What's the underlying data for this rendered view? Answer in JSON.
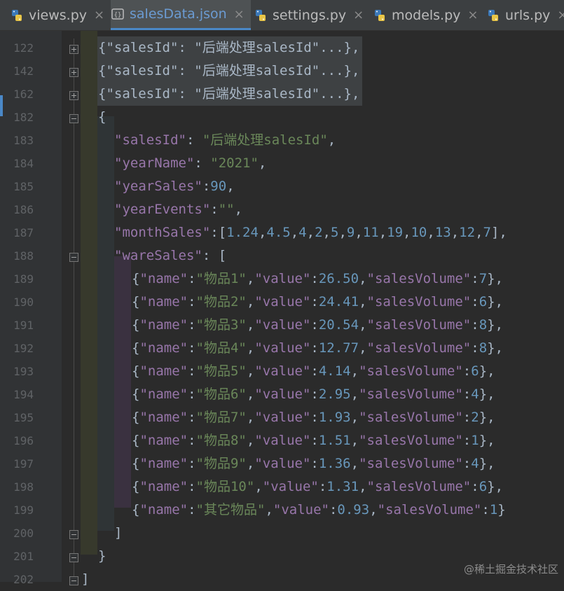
{
  "tabs": [
    {
      "label": "views.py",
      "active": false,
      "icon": "python-file-icon"
    },
    {
      "label": "salesData.json",
      "active": true,
      "icon": "json-file-icon"
    },
    {
      "label": "settings.py",
      "active": false,
      "icon": "python-file-icon"
    },
    {
      "label": "models.py",
      "active": false,
      "icon": "python-file-icon"
    },
    {
      "label": "urls.py",
      "active": false,
      "icon": "python-file-icon"
    }
  ],
  "tab_close_glyph": "×",
  "line_numbers": [
    "122",
    "142",
    "162",
    "182",
    "183",
    "184",
    "185",
    "186",
    "187",
    "188",
    "189",
    "190",
    "191",
    "192",
    "193",
    "194",
    "195",
    "196",
    "197",
    "198",
    "199",
    "200",
    "201",
    "202"
  ],
  "collapsed_text": "{\"salesId\": \"后端处理salesId\"...},",
  "code": {
    "l182": "{",
    "l183": [
      "\"salesId\"",
      ": ",
      "\"后端处理salesId\"",
      ","
    ],
    "l184": [
      "\"yearName\"",
      ": ",
      "\"2021\"",
      ","
    ],
    "l185": [
      "\"yearSales\"",
      ":",
      "90",
      ","
    ],
    "l186": [
      "\"yearEvents\"",
      ":",
      "\"\"",
      ","
    ],
    "l187": [
      "\"monthSales\"",
      ":[",
      "1.24",
      ",",
      "4.5",
      ",",
      "4",
      ",",
      "2",
      ",",
      "5",
      ",",
      "9",
      ",",
      "11",
      ",",
      "19",
      ",",
      "10",
      ",",
      "13",
      ",",
      "12",
      ",",
      "7",
      "],"
    ],
    "l188": [
      "\"wareSales\"",
      ": ["
    ],
    "l200": "]",
    "l201": "}",
    "l202": "]"
  },
  "ware_sales": [
    {
      "name": "\"物品1\"",
      "value": "26.50",
      "volume": "7",
      "tail": "},"
    },
    {
      "name": "\"物品2\"",
      "value": "24.41",
      "volume": "6",
      "tail": "},"
    },
    {
      "name": "\"物品3\"",
      "value": "20.54",
      "volume": "8",
      "tail": "},"
    },
    {
      "name": "\"物品4\"",
      "value": "12.77",
      "volume": "8",
      "tail": "},"
    },
    {
      "name": "\"物品5\"",
      "value": "4.14",
      "volume": "6",
      "tail": "},"
    },
    {
      "name": "\"物品6\"",
      "value": "2.95",
      "volume": "4",
      "tail": "},"
    },
    {
      "name": "\"物品7\"",
      "value": "1.93",
      "volume": "2",
      "tail": "},"
    },
    {
      "name": "\"物品8\"",
      "value": "1.51",
      "volume": "1",
      "tail": "},"
    },
    {
      "name": "\"物品9\"",
      "value": "1.36",
      "volume": "4",
      "tail": "},"
    },
    {
      "name": "\"物品10\"",
      "value": "1.31",
      "volume": "6",
      "tail": "},"
    },
    {
      "name": "\"其它物品\"",
      "value": "0.93",
      "volume": "1",
      "tail": "}"
    }
  ],
  "ware_keys": {
    "open": "{",
    "name_key": "\"name\"",
    "value_key": "\"value\"",
    "volume_key": "\"salesVolume\""
  },
  "watermark": "@稀土掘金技术社区",
  "colors": {
    "key": "#9876aa",
    "string": "#6a8759",
    "number": "#6897bb",
    "text": "#a9b7c6",
    "accent": "#4a88c7"
  }
}
